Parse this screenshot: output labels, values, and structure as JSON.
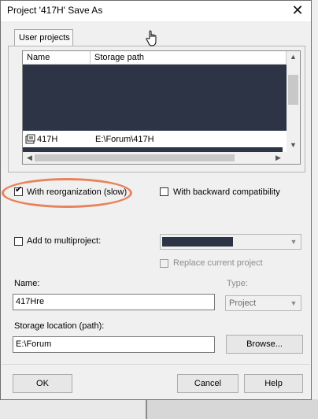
{
  "dialog": {
    "title": "Project '417H' Save As",
    "close_glyph": "✕"
  },
  "tab": {
    "label": "User projects"
  },
  "list": {
    "columns": [
      "Name",
      "Storage path"
    ],
    "rows": [
      {
        "name": "417H",
        "path": "E:\\Forum\\417H",
        "icon": "project-icon"
      }
    ],
    "scroll_up": "▲",
    "scroll_down": "▼",
    "scroll_left": "◀",
    "scroll_right": "▶"
  },
  "options": {
    "reorganization": {
      "label": "With reorganization (slow)",
      "checked": true
    },
    "backward_compat": {
      "label": "With backward compatibility",
      "checked": false
    },
    "multiproject": {
      "label": "Add to multiproject:",
      "checked": false
    },
    "replace_project": {
      "label": "Replace current project",
      "checked": false
    }
  },
  "name_field": {
    "label": "Name:",
    "value": "417Hre"
  },
  "type_field": {
    "label": "Type:",
    "value": "Project"
  },
  "storage_field": {
    "label": "Storage location (path):",
    "value": "E:\\Forum"
  },
  "buttons": {
    "browse": "Browse...",
    "ok": "OK",
    "cancel": "Cancel",
    "help": "Help"
  },
  "colors": {
    "highlight_ring": "#e9825c",
    "redaction": "#2c3446"
  },
  "icons": {
    "dropdown_arrow": "▼",
    "checkmark": "✔"
  }
}
